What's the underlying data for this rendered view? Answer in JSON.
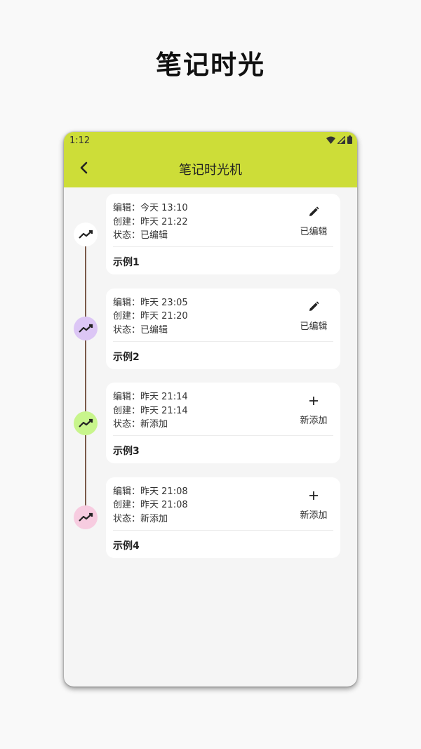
{
  "promo": {
    "title": "笔记时光"
  },
  "status_bar": {
    "time": "1:12"
  },
  "app_bar": {
    "title": "笔记时光机"
  },
  "colors": {
    "accent": "#cddd38"
  },
  "notes": [
    {
      "edit_label": "编辑：",
      "edited": "今天 13:10",
      "create_label": "创建：",
      "created": "昨天 21:22",
      "state_label": "状态：",
      "state": "已编辑",
      "action_icon": "pencil-icon",
      "action_label": "已编辑",
      "title": "示例1",
      "node_color": "#ffffff"
    },
    {
      "edit_label": "编辑：",
      "edited": "昨天 23:05",
      "create_label": "创建：",
      "created": "昨天 21:20",
      "state_label": "状态：",
      "state": "已编辑",
      "action_icon": "pencil-icon",
      "action_label": "已编辑",
      "title": "示例2",
      "node_color": "#dcc6f5"
    },
    {
      "edit_label": "编辑：",
      "edited": "昨天 21:14",
      "create_label": "创建：",
      "created": "昨天 21:14",
      "state_label": "状态：",
      "state": "新添加",
      "action_icon": "plus-icon",
      "action_label": "新添加",
      "title": "示例3",
      "node_color": "#c8f58c"
    },
    {
      "edit_label": "编辑：",
      "edited": "昨天 21:08",
      "create_label": "创建：",
      "created": "昨天 21:08",
      "state_label": "状态：",
      "state": "新添加",
      "action_icon": "plus-icon",
      "action_label": "新添加",
      "title": "示例4",
      "node_color": "#f7cce0"
    }
  ]
}
